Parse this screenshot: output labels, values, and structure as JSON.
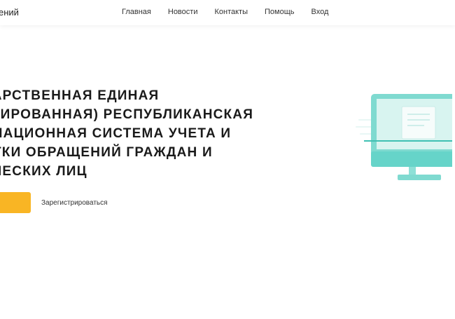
{
  "header": {
    "brand_fragment": "ений",
    "nav": [
      {
        "label": "Главная"
      },
      {
        "label": "Новости"
      },
      {
        "label": "Контакты"
      },
      {
        "label": "Помощь"
      },
      {
        "label": "Вход"
      }
    ]
  },
  "hero": {
    "title_lines": [
      "ДАРСТВЕННАЯ ЕДИНАЯ",
      "ТРИРОВАННАЯ) РЕСПУБЛИКАНСКАЯ",
      "РМАЦИОННАЯ СИСТЕМА УЧЕТА И",
      "ОТКИ ОБРАЩЕНИЙ ГРАЖДАН И",
      "ИЧЕСКИХ ЛИЦ"
    ],
    "primary_button_label": "",
    "register_link": "Зарегистрироваться"
  },
  "illustration": {
    "icon": "computer-monitor-icon",
    "colors": {
      "frame": "#5fd1c6",
      "screen": "#d3f2ee",
      "stand": "#8ee0d7"
    }
  },
  "colors": {
    "accent_button": "#f9b524",
    "text": "#1a1a1a"
  }
}
